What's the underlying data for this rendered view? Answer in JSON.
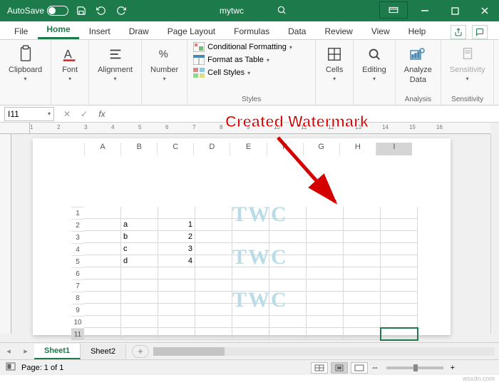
{
  "title_bar": {
    "autosave_label": "AutoSave",
    "workbook_name": "mytwc"
  },
  "tabs": {
    "file": "File",
    "home": "Home",
    "insert": "Insert",
    "draw": "Draw",
    "page_layout": "Page Layout",
    "formulas": "Formulas",
    "data": "Data",
    "review": "Review",
    "view": "View",
    "help": "Help"
  },
  "ribbon": {
    "clipboard": {
      "label": "Clipboard"
    },
    "font": {
      "label": "Font"
    },
    "alignment": {
      "label": "Alignment"
    },
    "number": {
      "label": "Number"
    },
    "styles": {
      "label": "Styles",
      "conditional": "Conditional Formatting",
      "table": "Format as Table",
      "cell": "Cell Styles"
    },
    "cells": {
      "label": "Cells"
    },
    "editing": {
      "label": "Editing"
    },
    "analysis": {
      "label": "Analysis",
      "btn_top": "Analyze",
      "btn_bottom": "Data"
    },
    "sensitivity": {
      "label": "Sensitivity",
      "btn_top": "Sensitivity"
    }
  },
  "formula_bar": {
    "name_box": "I11",
    "fx": "fx"
  },
  "annotation": "Created Watermark",
  "ruler_ticks": [
    "1",
    "2",
    "3",
    "4",
    "5",
    "6",
    "7",
    "8",
    "9",
    "10",
    "11",
    "12",
    "13",
    "14",
    "15",
    "16"
  ],
  "columns": [
    "A",
    "B",
    "C",
    "D",
    "E",
    "F",
    "G",
    "H",
    "I"
  ],
  "rows": [
    "1",
    "2",
    "3",
    "4",
    "5",
    "6",
    "7",
    "8",
    "9",
    "10",
    "11"
  ],
  "cells": {
    "B2": "a",
    "C2": "1",
    "B3": "b",
    "C3": "2",
    "B4": "c",
    "C4": "3",
    "B5": "d",
    "C5": "4"
  },
  "watermark_text": "TWC",
  "sheet_tabs": {
    "s1": "Sheet1",
    "s2": "Sheet2",
    "add": "+"
  },
  "status": {
    "page": "Page: 1 of 1",
    "zoom": "--",
    "plus": "+",
    "brand": "wsxdn.com"
  }
}
